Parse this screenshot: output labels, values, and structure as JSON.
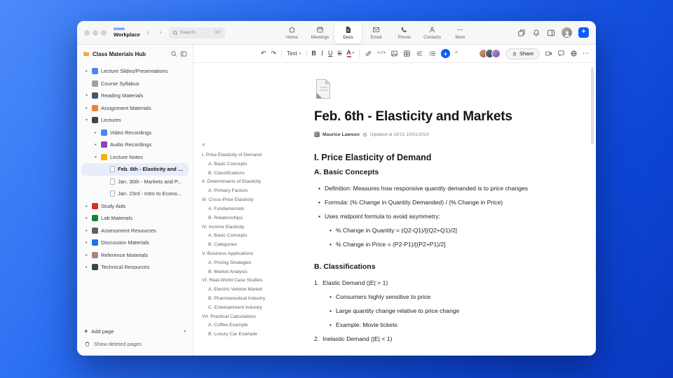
{
  "window": {
    "brand": {
      "top": "zoom",
      "bottom": "Workplace"
    },
    "back_arrow": "‹",
    "forward_arrow": "›",
    "search": {
      "placeholder": "Search",
      "shortcut": "⌘F"
    },
    "nav_tabs": [
      {
        "label": "Home"
      },
      {
        "label": "Meetings"
      },
      {
        "label": "Docs"
      },
      {
        "label": "Email"
      },
      {
        "label": "Phone"
      },
      {
        "label": "Contacts"
      },
      {
        "label": "More"
      }
    ],
    "new_button": "+",
    "accent_color": "#0b5cff"
  },
  "sidebar": {
    "title": "Class Materials Hub",
    "items": [
      {
        "chevron": "▸",
        "icon": "presentation-icon",
        "icon_color": "#4a86f7",
        "label": "Lecture Slides/Presentations"
      },
      {
        "chevron": "",
        "icon": "document-icon",
        "icon_color": "#9aa0a6",
        "label": "Course Syllabus"
      },
      {
        "chevron": "▾",
        "icon": "book-icon",
        "icon_color": "#455a64",
        "label": "Reading Materials"
      },
      {
        "chevron": "▸",
        "icon": "folder-icon",
        "icon_color": "#e8833a",
        "label": "Assignment Materials"
      },
      {
        "chevron": "▾",
        "icon": "lecture-icon",
        "icon_color": "#37474f",
        "label": "Lectures"
      },
      {
        "chevron": "▸",
        "icon": "video-icon",
        "icon_color": "#4a86f7",
        "label": "Video Recordings"
      },
      {
        "chevron": "▸",
        "icon": "audio-icon",
        "icon_color": "#8e44ad",
        "label": "Audio Recordings"
      },
      {
        "chevron": "▾",
        "icon": "note-icon",
        "icon_color": "#f4b400",
        "label": "Lecture Notes"
      },
      {
        "chevron": "",
        "icon": "page-icon",
        "icon_color": "",
        "label": "Feb. 6th - Elasticity and M...",
        "selected": true
      },
      {
        "chevron": "",
        "icon": "page-icon",
        "icon_color": "",
        "label": "Jan. 30th - Markets and P..."
      },
      {
        "chevron": "",
        "icon": "page-icon",
        "icon_color": "",
        "label": "Jan. 23rd - Intro to Econo..."
      },
      {
        "chevron": "▸",
        "icon": "red-book-icon",
        "icon_color": "#d93025",
        "label": "Study Aids"
      },
      {
        "chevron": "▸",
        "icon": "lab-icon",
        "icon_color": "#188038",
        "label": "Lab Materials"
      },
      {
        "chevron": "▸",
        "icon": "clipboard-icon",
        "icon_color": "#5f6368",
        "label": "Assessment Resources"
      },
      {
        "chevron": "▸",
        "icon": "chat-icon",
        "icon_color": "#1a73e8",
        "label": "Discussion Materials"
      },
      {
        "chevron": "▸",
        "icon": "books-icon",
        "icon_color": "#a1887f",
        "label": "Reference Materials"
      },
      {
        "chevron": "▸",
        "icon": "device-icon",
        "icon_color": "#37474f",
        "label": "Technical Resources"
      }
    ],
    "add_page": {
      "plus": "+",
      "label": "Add page",
      "chevron": "▾"
    },
    "show_deleted": {
      "label": "Show deleted pages"
    }
  },
  "toolbar": {
    "undo": "↶",
    "redo": "↷",
    "text_style": {
      "label": "Text",
      "caret": "▾"
    },
    "bold": "B",
    "italic": "I",
    "underline": "U",
    "strike": "S",
    "color": {
      "label": "A",
      "caret": "▾"
    },
    "code": "</>",
    "insert": "+",
    "collapse": "^",
    "share_label": "Share",
    "more": "⋯"
  },
  "doc": {
    "title": "Feb. 6th - Elasticity and Markets",
    "author": "Maurice Lawson",
    "updated": "Updated at 19:01 10/01/2020",
    "outline_collapse": "«",
    "outline": [
      {
        "text": "I. Price Elasticity of Demand",
        "level": 0
      },
      {
        "text": "A. Basic Concepts",
        "level": 1
      },
      {
        "text": "B. Classifications",
        "level": 1
      },
      {
        "text": "II. Determinants of Elasticity",
        "level": 0
      },
      {
        "text": "A. Primary Factors",
        "level": 1
      },
      {
        "text": "III. Cross-Price Elasticity",
        "level": 0
      },
      {
        "text": "A. Fundamentals",
        "level": 1
      },
      {
        "text": "B. Relationships",
        "level": 1
      },
      {
        "text": "IV. Income Elasticity",
        "level": 0
      },
      {
        "text": "A. Basic Concepts",
        "level": 1
      },
      {
        "text": "B. Categories",
        "level": 1
      },
      {
        "text": "V. Business Applications",
        "level": 0
      },
      {
        "text": "A. Pricing Strategies",
        "level": 1
      },
      {
        "text": "B. Market Analysis",
        "level": 1
      },
      {
        "text": "VI. Real-World Case Studies",
        "level": 0
      },
      {
        "text": "A. Electric Vehicle Market",
        "level": 1
      },
      {
        "text": "B. Pharmaceutical Industry",
        "level": 1
      },
      {
        "text": "C. Entertainment Industry",
        "level": 1
      },
      {
        "text": "VII. Practical Calculations",
        "level": 0
      },
      {
        "text": "A. Coffee Example",
        "level": 1
      },
      {
        "text": "B. Luxury Car Example",
        "level": 1
      }
    ],
    "body": [
      {
        "type": "h2",
        "text": "I. Price Elasticity of Demand"
      },
      {
        "type": "h3",
        "text": "A. Basic Concepts"
      },
      {
        "type": "li1",
        "text": "Definition: Measures how responsive quantity demanded is to price changes"
      },
      {
        "type": "li1",
        "text": "Formula: (% Change in Quantity Demanded) / (% Change in Price)"
      },
      {
        "type": "li1",
        "text": "Uses midpoint formula to avoid asymmetry:"
      },
      {
        "type": "li2",
        "text": "% Change in Quantity = (Q2-Q1)/[(Q2+Q1)/2]"
      },
      {
        "type": "li2",
        "text": "% Change in Price = (P2-P1)/[(P2+P1)/2]"
      },
      {
        "type": "h3",
        "text": "B. Classifications"
      },
      {
        "type": "num",
        "marker": "1.",
        "text": "Elastic Demand (|E| > 1)"
      },
      {
        "type": "li2",
        "text": "Consumers highly sensitive to price"
      },
      {
        "type": "li2",
        "text": "Large quantity change relative to price change"
      },
      {
        "type": "li2",
        "text": "Example: Movie tickets"
      },
      {
        "type": "num",
        "marker": "2.",
        "text": "Inelastic Demand (|E| < 1)"
      }
    ]
  }
}
